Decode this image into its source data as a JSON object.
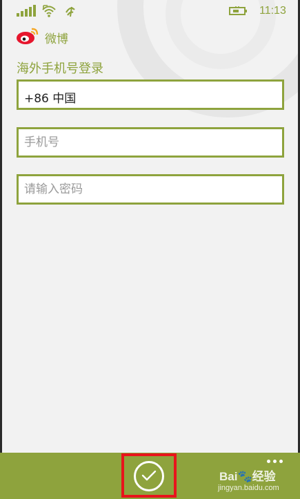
{
  "status_bar": {
    "time": "11:13",
    "icons": [
      "signal-icon",
      "wifi-icon",
      "roaming-icon",
      "battery-charging-icon"
    ]
  },
  "app": {
    "name": "微博",
    "logo_icon": "weibo-logo-icon"
  },
  "page": {
    "title": "海外手机号登录"
  },
  "form": {
    "country_code": "+86   中国",
    "phone_placeholder": "手机号",
    "password_placeholder": "请输入密码"
  },
  "app_bar": {
    "confirm_icon": "checkmark-icon",
    "more_icon": "more-dots-icon"
  },
  "watermark": {
    "brand": "Bai",
    "brand_suffix": "经验",
    "url": "jingyan.baidu.com"
  },
  "colors": {
    "accent": "#8ea33d",
    "background": "#f2f2f2",
    "highlight_box": "#e8141c"
  }
}
